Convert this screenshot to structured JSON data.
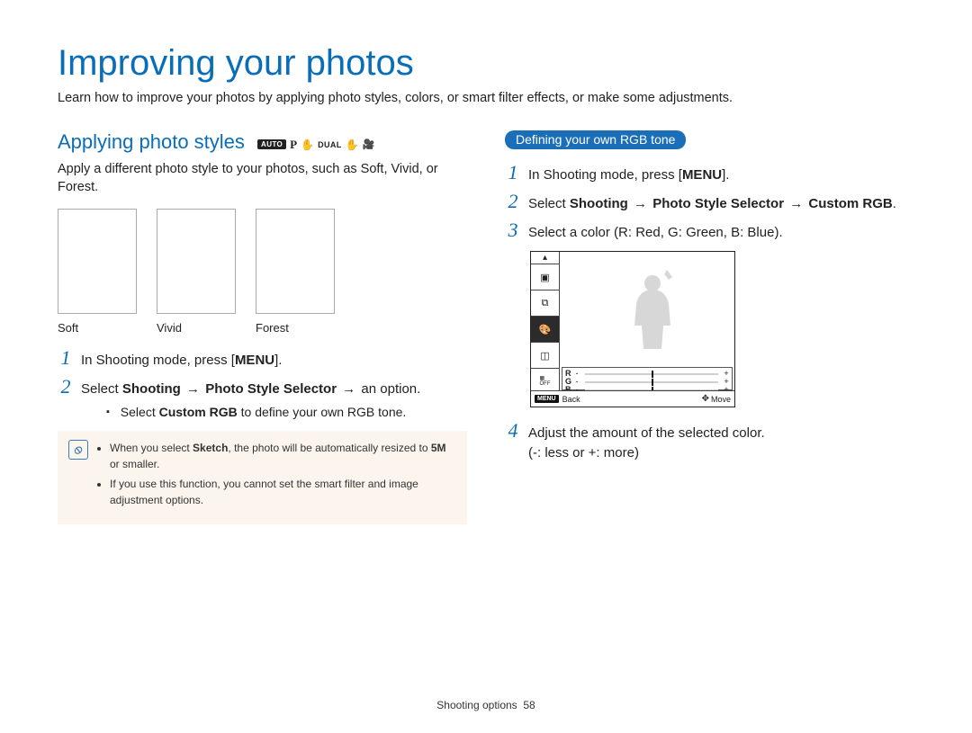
{
  "page": {
    "title": "Improving your photos",
    "intro": "Learn how to improve your photos by applying photo styles, colors, or smart filter effects, or make some adjustments.",
    "footer_section": "Shooting options",
    "footer_page": "58"
  },
  "modes": {
    "auto": "AUTO",
    "p": "P",
    "dual": "DUAL"
  },
  "left": {
    "subhead": "Applying photo styles",
    "body": "Apply a different photo style to your photos, such as Soft, Vivid, or Forest.",
    "thumbs": [
      "Soft",
      "Vivid",
      "Forest"
    ],
    "step1_prefix": "In Shooting mode, press [",
    "step1_menu": "MENU",
    "step1_suffix": "].",
    "step2_select": "Select ",
    "step2_a": "Shooting",
    "step2_b": "Photo Style Selector",
    "step2_tail": "an option.",
    "arrow": "→",
    "bullet_prefix": "Select ",
    "bullet_bold": "Custom RGB",
    "bullet_suffix": " to define your own RGB tone.",
    "note1_a": "When you select ",
    "note1_b": "Sketch",
    "note1_c": ", the photo will be automatically resized to ",
    "note1_d": "5M",
    "note1_e": " or smaller.",
    "note2": "If you use this function, you cannot set the smart filter and image adjustment options."
  },
  "right": {
    "heading": "Defining your own RGB tone",
    "step1_prefix": "In Shooting mode, press [",
    "step1_menu": "MENU",
    "step1_suffix": "].",
    "step2_select": "Select ",
    "step2_a": "Shooting",
    "step2_b": "Photo Style Selector",
    "step2_c": "Custom RGB",
    "step3": "Select a color (R: Red, G: Green, B: Blue).",
    "step4_a": "Adjust the amount of the selected color.",
    "step4_b": "(-: less or +: more)",
    "screen": {
      "off": "OFF",
      "r": "R",
      "g": "G",
      "b": "B",
      "menu": "MENU",
      "back": "Back",
      "move": "Move",
      "minus": "-",
      "plus": "+"
    }
  }
}
